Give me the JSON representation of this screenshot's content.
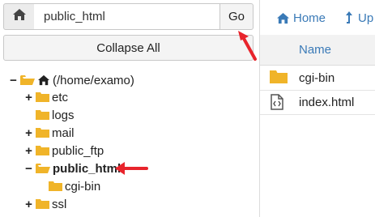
{
  "pathbar": {
    "path_value": "public_html",
    "go_label": "Go"
  },
  "tree": {
    "collapse_label": "Collapse All",
    "root_label": "(/home/examo)",
    "items": [
      {
        "label": "etc",
        "toggle": "+"
      },
      {
        "label": "logs",
        "toggle": ""
      },
      {
        "label": "mail",
        "toggle": "+"
      },
      {
        "label": "public_ftp",
        "toggle": "+"
      },
      {
        "label": "public_html",
        "toggle": "−"
      },
      {
        "label": "cgi-bin",
        "toggle": ""
      },
      {
        "label": "ssl",
        "toggle": "+"
      }
    ],
    "root_toggle": "−"
  },
  "toolbar": {
    "home_label": "Home",
    "up_label": "Up"
  },
  "file_table": {
    "column_name": "Name",
    "rows": [
      {
        "name": "cgi-bin",
        "icon": "folder-icon"
      },
      {
        "name": "index.html",
        "icon": "html-file-icon"
      }
    ]
  },
  "colors": {
    "folder": "#f0b429",
    "link": "#3a7ab7",
    "arrow": "#e8242c"
  }
}
